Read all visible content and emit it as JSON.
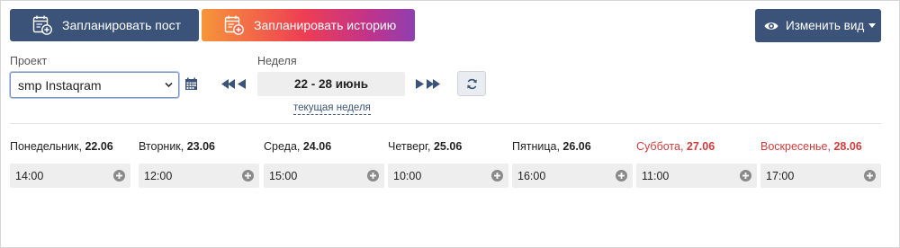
{
  "toolbar": {
    "plan_post_label": "Запланировать пост",
    "plan_story_label": "Запланировать историю",
    "change_view_label": "Изменить вид"
  },
  "project": {
    "label": "Проект",
    "selected": "smp Instaqram"
  },
  "week": {
    "label": "Неделя",
    "range": "22 - 28 июнь",
    "current_week_link": "текущая неделя"
  },
  "colors": {
    "primary": "#3b5378",
    "weekend": "#d33b3b",
    "slot_bg": "#eeeeee"
  },
  "days": [
    {
      "name": "Понедельник, ",
      "date": "22.06",
      "time": "14:00",
      "weekend": false
    },
    {
      "name": "Вторник, ",
      "date": "23.06",
      "time": "12:00",
      "weekend": false
    },
    {
      "name": "Среда, ",
      "date": "24.06",
      "time": "15:00",
      "weekend": false
    },
    {
      "name": "Четверг, ",
      "date": "25.06",
      "time": "10:00",
      "weekend": false
    },
    {
      "name": "Пятница, ",
      "date": "26.06",
      "time": "16:00",
      "weekend": false
    },
    {
      "name": "Суббота, ",
      "date": "27.06",
      "time": "11:00",
      "weekend": true
    },
    {
      "name": "Воскресенье, ",
      "date": "28.06",
      "time": "17:00",
      "weekend": true
    }
  ]
}
